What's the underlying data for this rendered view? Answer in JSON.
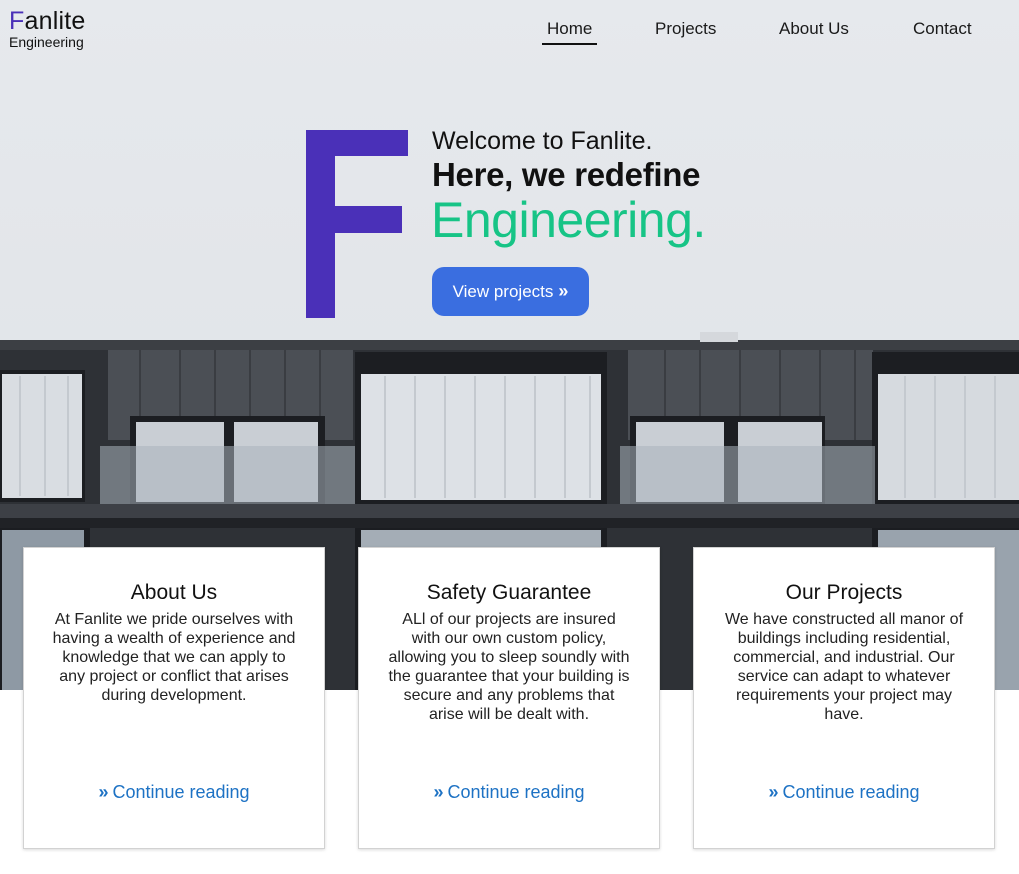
{
  "brand": {
    "initial": "F",
    "name_rest": "anlite",
    "subtitle": "Engineering",
    "accent_color": "#4a30b8"
  },
  "nav": {
    "items": [
      {
        "label": "Home",
        "active": true
      },
      {
        "label": "Projects",
        "active": false
      },
      {
        "label": "About Us",
        "active": false
      },
      {
        "label": "Contact",
        "active": false
      }
    ]
  },
  "hero": {
    "welcome": "Welcome to Fanlite.",
    "tagline": "Here, we redefine",
    "highlight": "Engineering.",
    "highlight_color": "#17c486",
    "cta_label": "View projects",
    "cta_icon": "double-chevron-right-icon",
    "cta_color": "#3a6ee0",
    "logo_letter_color": "#4a30b8"
  },
  "cards": [
    {
      "title": "About Us",
      "body": "At Fanlite we pride ourselves with having a wealth of experience and knowledge that we can apply to any project or conflict that arises during development.",
      "link": "Continue reading"
    },
    {
      "title": "Safety Guarantee",
      "body": "ALl of our projects are insured with our own custom policy, allowing you to sleep soundly with the guarantee that your building is secure and any problems that arise will be dealt with.",
      "link": "Continue reading"
    },
    {
      "title": "Our Projects",
      "body": "We have constructed all manor of buildings including residential, commercial, and industrial. Our service can adapt to whatever requirements your project may have.",
      "link": "Continue reading"
    }
  ],
  "link_color": "#1d72c4"
}
